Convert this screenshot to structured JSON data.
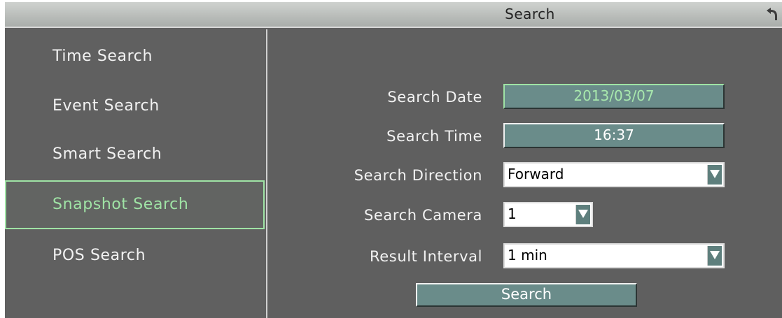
{
  "window": {
    "title": "Search"
  },
  "sidebar": {
    "items": [
      {
        "label": "Time Search",
        "active": false
      },
      {
        "label": "Event Search",
        "active": false
      },
      {
        "label": "Smart Search",
        "active": false
      },
      {
        "label": "Snapshot Search",
        "active": true
      },
      {
        "label": "POS Search",
        "active": false
      }
    ]
  },
  "form": {
    "search_date": {
      "label": "Search Date",
      "value": "2013/03/07"
    },
    "search_time": {
      "label": "Search Time",
      "value": "16:37"
    },
    "search_direction": {
      "label": "Search Direction",
      "value": "Forward"
    },
    "search_camera": {
      "label": "Search Camera",
      "value": "1"
    },
    "result_interval": {
      "label": "Result Interval",
      "value": "1 min"
    },
    "search_button": "Search"
  },
  "icons": {
    "back": "back-arrow-icon",
    "dropdown": "dropdown-arrow-icon"
  },
  "colors": {
    "accent": "#9fe3a5",
    "field": "#6a8c8a",
    "background": "#5f5f5f"
  }
}
